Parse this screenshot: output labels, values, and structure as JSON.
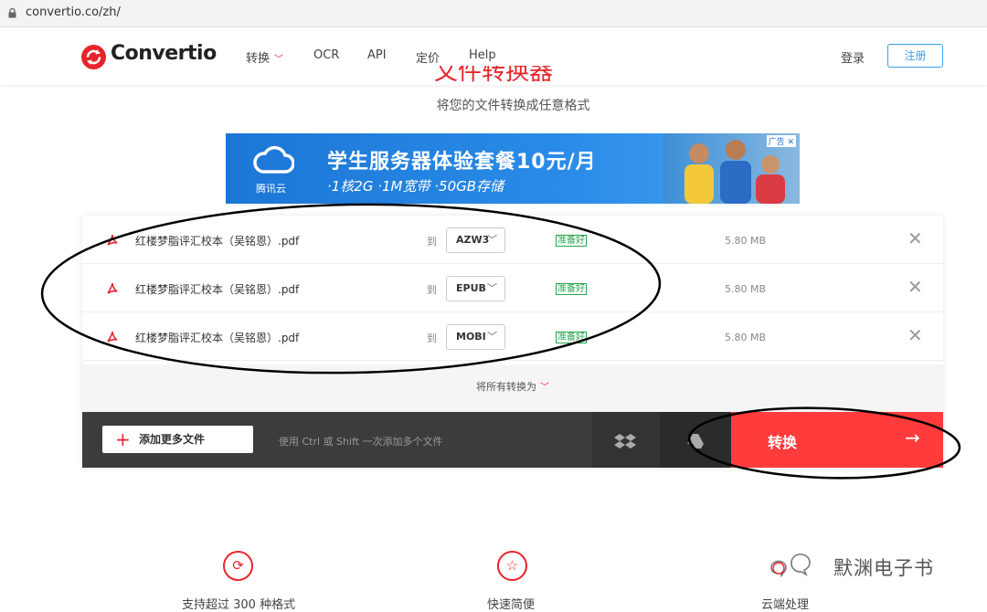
{
  "browser": {
    "url": "convertio.co/zh/"
  },
  "header": {
    "logo": "Convertio",
    "nav": [
      {
        "label": "转换",
        "has_dropdown": true
      },
      {
        "label": "OCR"
      },
      {
        "label": "API"
      },
      {
        "label": "定价"
      },
      {
        "label": "Help"
      }
    ],
    "login": "登录",
    "signup": "注册"
  },
  "hero": {
    "title": "文件转换器",
    "subtitle": "将您的文件转换成任意格式"
  },
  "ad": {
    "brand": "腾讯云",
    "headline": "学生服务器体验套餐10元/月",
    "specs": "·1核2G ·1M宽带 ·50GB存储",
    "tag": "广告"
  },
  "files": [
    {
      "name": "红楼梦脂评汇校本（吴铭恩）.pdf",
      "to": "到",
      "format": "AZW3",
      "status": "准备好",
      "size": "5.80 MB"
    },
    {
      "name": "红楼梦脂评汇校本（吴铭恩）.pdf",
      "to": "到",
      "format": "EPUB",
      "status": "准备好",
      "size": "5.80 MB"
    },
    {
      "name": "红楼梦脂评汇校本（吴铭恩）.pdf",
      "to": "到",
      "format": "MOBI",
      "status": "准备好",
      "size": "5.80 MB"
    }
  ],
  "convert_all": "将所有转换为",
  "bottom": {
    "add_more": "添加更多文件",
    "hint": "使用 Ctrl 或 Shift 一次添加多个文件",
    "convert": "转换"
  },
  "features": [
    {
      "label": "支持超过 300 种格式"
    },
    {
      "label": "快速简便"
    },
    {
      "label": "云端处理"
    }
  ],
  "watermark": "默渊电子书",
  "colors": {
    "brand_red": "#e8232b",
    "convert_red": "#ff3b3b",
    "ready_green": "#2aa34c",
    "signup_blue": "#3aa0e8"
  }
}
